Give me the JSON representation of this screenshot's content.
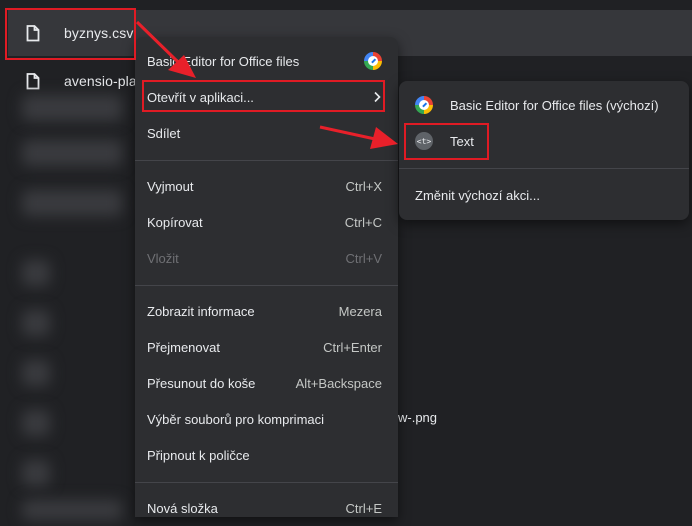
{
  "files": [
    {
      "name": "byznys.csv",
      "selected": true
    },
    {
      "name": "avensio-pla",
      "selected": false
    }
  ],
  "background_partial_text": "w-.png",
  "context_menu": {
    "items": [
      {
        "label": "Basic Editor for Office files",
        "shortcut": "",
        "icon": "basic-editor-icon"
      },
      {
        "label": "Otevřít v aplikaci...",
        "shortcut": "",
        "icon": "chevron-right-icon"
      },
      {
        "label": "Sdílet",
        "shortcut": ""
      },
      {
        "label": "Vyjmout",
        "shortcut": "Ctrl+X"
      },
      {
        "label": "Kopírovat",
        "shortcut": "Ctrl+C"
      },
      {
        "label": "Vložit",
        "shortcut": "Ctrl+V",
        "disabled": true
      },
      {
        "label": "Zobrazit informace",
        "shortcut": "Mezera"
      },
      {
        "label": "Přejmenovat",
        "shortcut": "Ctrl+Enter"
      },
      {
        "label": "Přesunout do koše",
        "shortcut": "Alt+Backspace"
      },
      {
        "label": "Výběr souborů pro komprimaci",
        "shortcut": ""
      },
      {
        "label": "Připnout k poličce",
        "shortcut": ""
      },
      {
        "label": "Nová složka",
        "shortcut": "Ctrl+E"
      }
    ]
  },
  "submenu": {
    "items": [
      {
        "label": "Basic Editor for Office files (výchozí)",
        "icon": "basic-editor-icon"
      },
      {
        "label": "Text",
        "icon": "text-app-icon",
        "icon_glyph": "<t>"
      },
      {
        "label": "Změnit výchozí akci..."
      }
    ]
  },
  "colors": {
    "background": "#202124",
    "menu": "#2d2e31",
    "highlight": "#e01b24",
    "arrow": "#e8202a"
  }
}
